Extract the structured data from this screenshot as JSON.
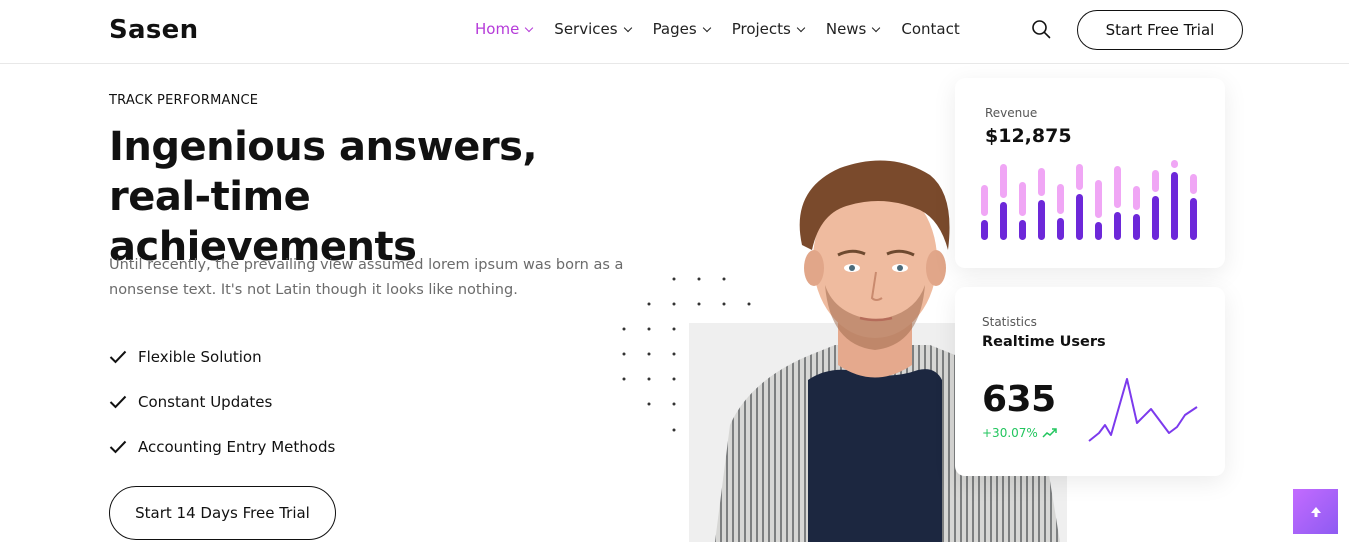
{
  "header": {
    "logo": "Sasen",
    "nav": [
      {
        "label": "Home",
        "active": true,
        "dropdown": true
      },
      {
        "label": "Services",
        "active": false,
        "dropdown": true
      },
      {
        "label": "Pages",
        "active": false,
        "dropdown": true
      },
      {
        "label": "Projects",
        "active": false,
        "dropdown": true
      },
      {
        "label": "News",
        "active": false,
        "dropdown": true
      },
      {
        "label": "Contact",
        "active": false,
        "dropdown": false
      }
    ],
    "search_icon": "search-icon",
    "trial_button": "Start Free Trial"
  },
  "hero": {
    "eyebrow": "TRACK PERFORMANCE",
    "title": "Ingenious answers, real-time achievements",
    "description": "Until recently, the prevailing view assumed lorem ipsum was born as a nonsense text. It's not Latin though it looks like nothing.",
    "features": [
      "Flexible Solution",
      "Constant Updates",
      "Accounting Entry Methods"
    ],
    "cta": "Start 14 Days Free Trial"
  },
  "revenue_card": {
    "label": "Revenue",
    "value": "$12,875"
  },
  "stats_card": {
    "label": "Statistics",
    "title": "Realtime Users",
    "value": "635",
    "change": "+30.07%"
  },
  "colors": {
    "accent": "#b53bd9",
    "bar_primary": "#6d28d9",
    "bar_secondary": "#f0a6f5",
    "line": "#7c3aed",
    "positive": "#22c55e"
  }
}
